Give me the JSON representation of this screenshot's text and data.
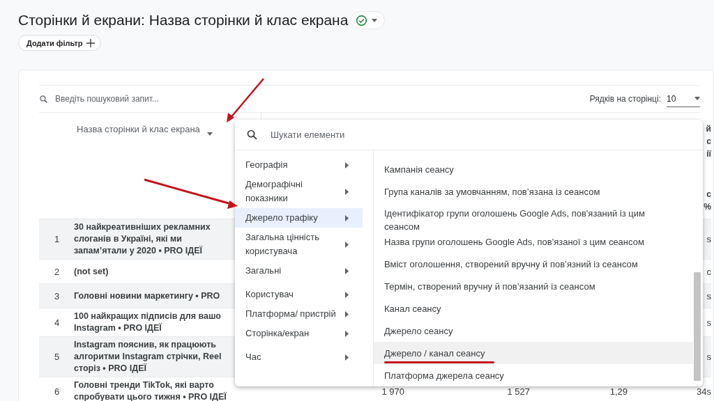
{
  "header": {
    "title": "Сторінки й екрани: Назва сторінки й клас екрана",
    "filter_button": "Додати фільтр"
  },
  "table": {
    "search_placeholder": "Введіть пошуковий запит...",
    "rows_per_page_label": "Рядків на сторінці:",
    "rows_per_page_value": "10",
    "dimension_header": "Назва сторінки й клас екрана",
    "edge_header_fragments": [
      "й",
      "с",
      "ії",
      "с",
      "%"
    ],
    "rows": [
      {
        "index": "1",
        "lines": [
          "30 найкреативніших рекламних",
          "слоганів в Україні, які ми",
          "запам’ятали у 2020 • PRO ІДЕЇ"
        ],
        "values": [
          "s"
        ]
      },
      {
        "index": "2",
        "lines": [
          "(not set)"
        ],
        "values": [
          "с"
        ]
      },
      {
        "index": "3",
        "lines": [
          "Головні новини маркетингу • PRO"
        ],
        "values": [
          "s"
        ]
      },
      {
        "index": "4",
        "lines": [
          "100 найкращих підписів для вашо",
          "Instagram • PRO ІДЕЇ"
        ],
        "values": [
          "s"
        ]
      },
      {
        "index": "5",
        "lines": [
          "Instagram пояснив, як працюють",
          "алгоритми Instagram стрічки, Reel",
          "сторіз • PRO ІДЕЇ"
        ],
        "values": [
          "s"
        ]
      },
      {
        "index": "6",
        "lines": [
          "Головні тренди TikTok, які варто",
          "спробувати цього тижня • PRO ІДЕЇ"
        ],
        "values": [
          "1 970",
          "1 527",
          "1,29",
          "34s"
        ]
      }
    ]
  },
  "menu": {
    "search_placeholder": "Шукати елементи",
    "categories": [
      {
        "label": "Географія",
        "selected": false
      },
      {
        "label": "Демографічні показники",
        "selected": false
      },
      {
        "label": "Джерело трафіку",
        "selected": true
      },
      {
        "label": "Загальна цінність користувача",
        "selected": false
      },
      {
        "label": "Загальні",
        "selected": false
      },
      {
        "label": "Користувач",
        "selected": false
      },
      {
        "label": "Платформа/ пристрій",
        "selected": false
      },
      {
        "label": "Сторінка/екран",
        "selected": false
      },
      {
        "label": "Час",
        "selected": false
      }
    ],
    "items": [
      {
        "label": "Кампанія сеансу",
        "selected": false,
        "underlined": false
      },
      {
        "label": "Група каналів за умовчанням, пов’язана із сеансом",
        "selected": false,
        "underlined": false
      },
      {
        "label": "Ідентифікатор групи оголошень Google Ads, пов'язаний із цим сеансом",
        "selected": false,
        "underlined": false
      },
      {
        "label": "Назва групи оголошень Google Ads, пов'язаної з цим сеансом",
        "selected": false,
        "underlined": false
      },
      {
        "label": "Вміст оголошення, створений вручну й пов’язний із сеансом",
        "selected": false,
        "underlined": false
      },
      {
        "label": "Термін, створений вручну й пов’язаний із сеансом",
        "selected": false,
        "underlined": false
      },
      {
        "label": "Канал сеансу",
        "selected": false,
        "underlined": false
      },
      {
        "label": "Джерело сеансу",
        "selected": false,
        "underlined": false
      },
      {
        "label": "Джерело / канал сеансу",
        "selected": true,
        "underlined": true
      },
      {
        "label": "Платформа джерела сеансу",
        "selected": false,
        "underlined": false
      }
    ]
  }
}
